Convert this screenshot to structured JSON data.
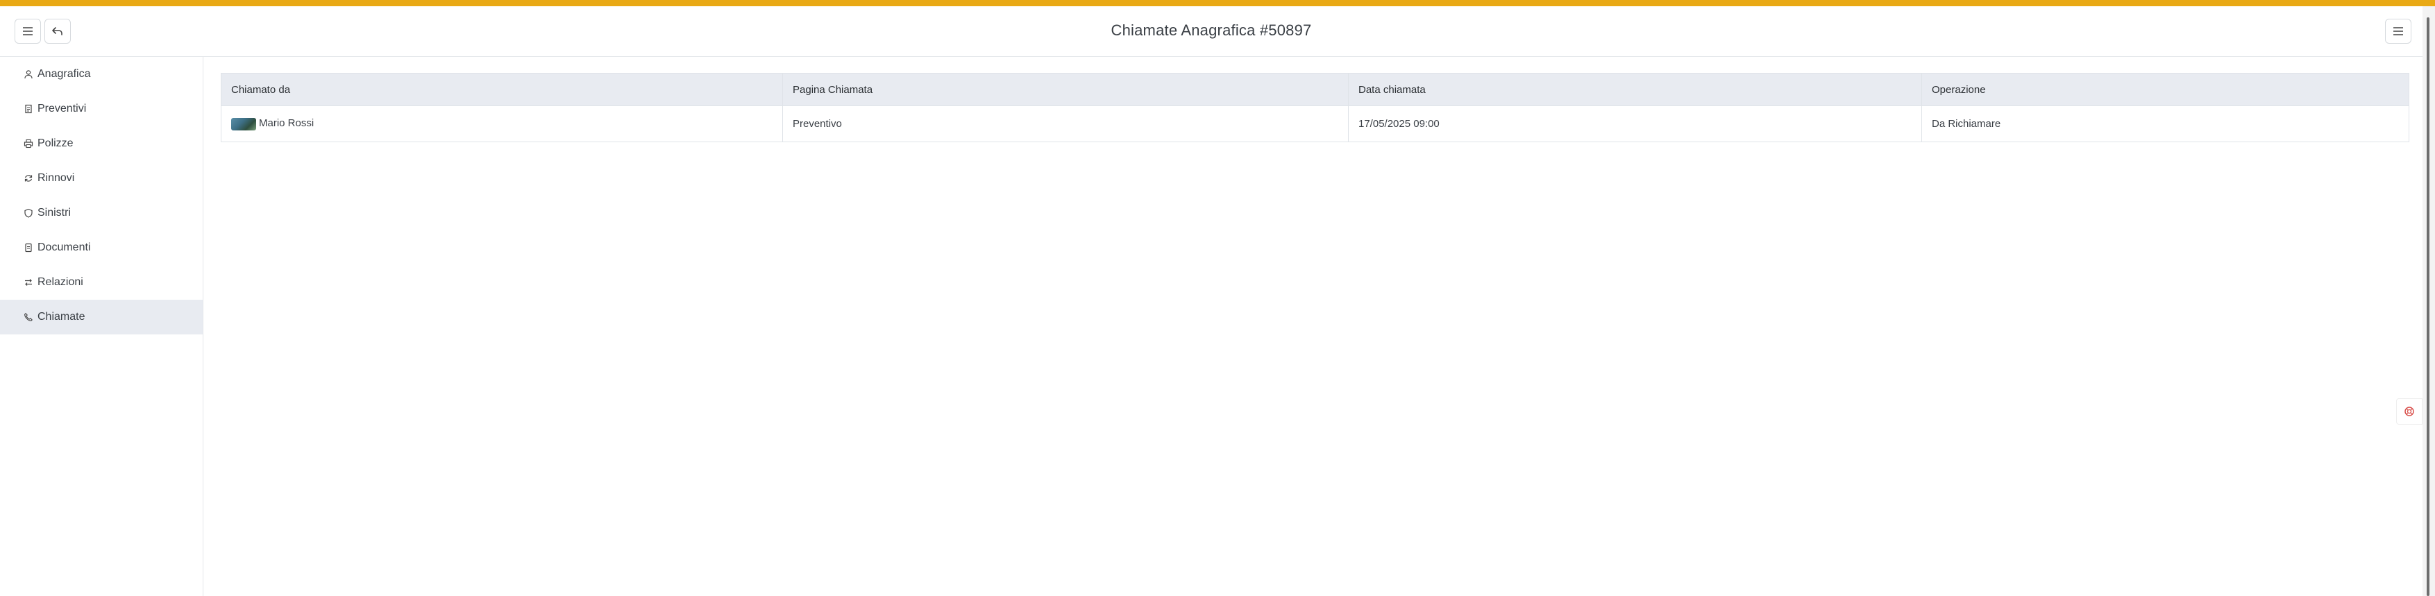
{
  "header": {
    "title": "Chiamate Anagrafica #50897",
    "menu_icon": "hamburger-icon",
    "back_icon": "undo-arrow-icon",
    "right_menu_icon": "hamburger-icon"
  },
  "colors": {
    "accent": "#e9a914",
    "active_nav": "#e8ebf1",
    "table_header": "#e8ebf1"
  },
  "sidebar": {
    "items": [
      {
        "label": "Anagrafica",
        "icon": "person-icon"
      },
      {
        "label": "Preventivi",
        "icon": "document-icon"
      },
      {
        "label": "Polizze",
        "icon": "printer-icon"
      },
      {
        "label": "Rinnovi",
        "icon": "refresh-icon"
      },
      {
        "label": "Sinistri",
        "icon": "shield-icon"
      },
      {
        "label": "Documenti",
        "icon": "file-icon"
      },
      {
        "label": "Relazioni",
        "icon": "swap-arrows-icon"
      },
      {
        "label": "Chiamate",
        "icon": "phone-icon"
      }
    ],
    "active": "Chiamate"
  },
  "table": {
    "columns": [
      "Chiamato da",
      "Pagina Chiamata",
      "Data chiamata",
      "Operazione"
    ],
    "rows": [
      {
        "caller": "Mario Rossi",
        "page": "Preventivo",
        "date": "17/05/2025 09:00",
        "operation": "Da Richiamare"
      }
    ]
  },
  "floating": {
    "icon": "lifebuoy-icon"
  }
}
